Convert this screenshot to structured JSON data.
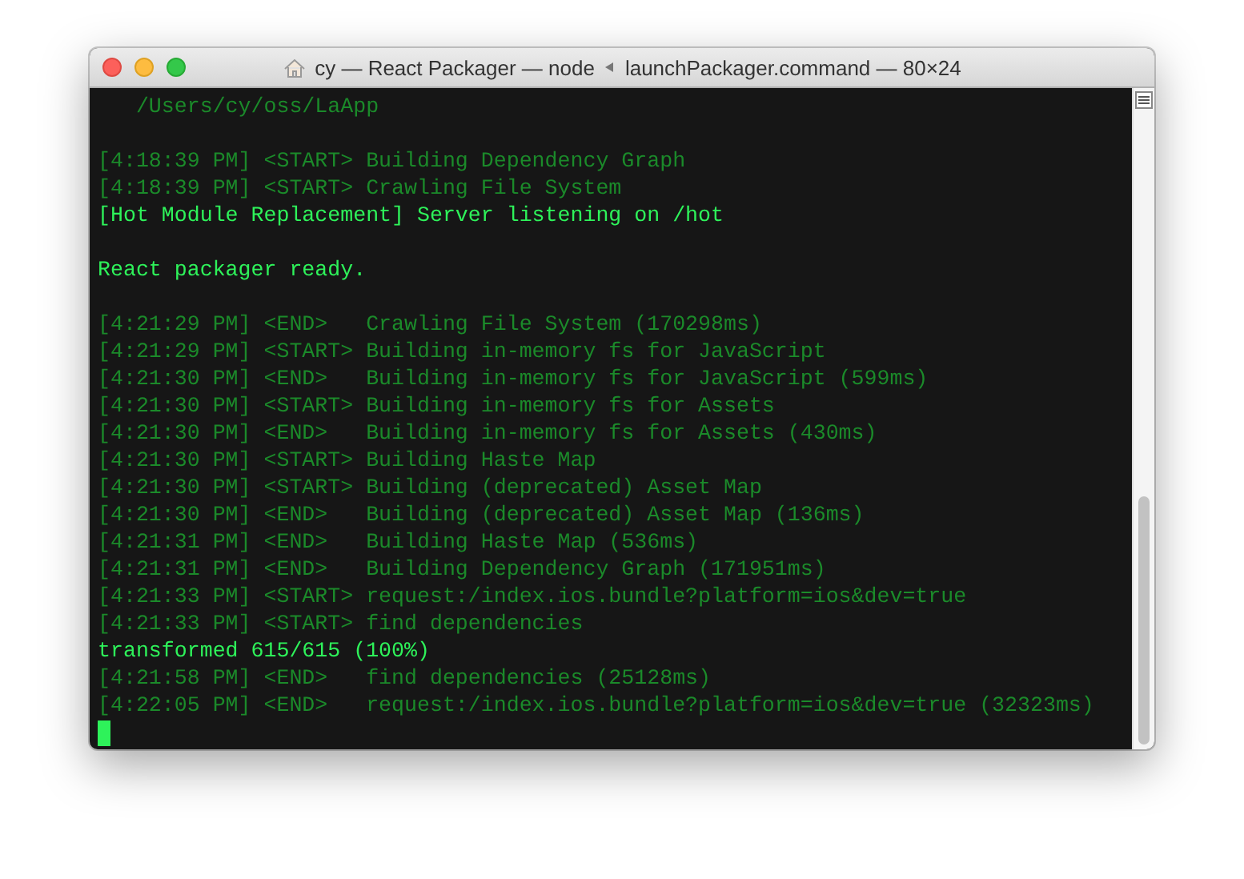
{
  "window": {
    "title_left": "cy — React Packager — node",
    "title_right": "launchPackager.command — 80×24"
  },
  "terminal": {
    "lines": [
      {
        "kind": "dim",
        "text": "   /Users/cy/oss/LaApp"
      },
      {
        "kind": "blank"
      },
      {
        "kind": "dim",
        "text": "[4:18:39 PM] <START> Building Dependency Graph"
      },
      {
        "kind": "dim",
        "text": "[4:18:39 PM] <START> Crawling File System"
      },
      {
        "kind": "bright",
        "text": "[Hot Module Replacement] Server listening on /hot"
      },
      {
        "kind": "blank"
      },
      {
        "kind": "bright",
        "text": "React packager ready."
      },
      {
        "kind": "blank"
      },
      {
        "kind": "dim",
        "text": "[4:21:29 PM] <END>   Crawling File System (170298ms)"
      },
      {
        "kind": "dim",
        "text": "[4:21:29 PM] <START> Building in-memory fs for JavaScript"
      },
      {
        "kind": "dim",
        "text": "[4:21:30 PM] <END>   Building in-memory fs for JavaScript (599ms)"
      },
      {
        "kind": "dim",
        "text": "[4:21:30 PM] <START> Building in-memory fs for Assets"
      },
      {
        "kind": "dim",
        "text": "[4:21:30 PM] <END>   Building in-memory fs for Assets (430ms)"
      },
      {
        "kind": "dim",
        "text": "[4:21:30 PM] <START> Building Haste Map"
      },
      {
        "kind": "dim",
        "text": "[4:21:30 PM] <START> Building (deprecated) Asset Map"
      },
      {
        "kind": "dim",
        "text": "[4:21:30 PM] <END>   Building (deprecated) Asset Map (136ms)"
      },
      {
        "kind": "dim",
        "text": "[4:21:31 PM] <END>   Building Haste Map (536ms)"
      },
      {
        "kind": "dim",
        "text": "[4:21:31 PM] <END>   Building Dependency Graph (171951ms)"
      },
      {
        "kind": "dim",
        "text": "[4:21:33 PM] <START> request:/index.ios.bundle?platform=ios&dev=true"
      },
      {
        "kind": "dim",
        "text": "[4:21:33 PM] <START> find dependencies"
      },
      {
        "kind": "bright",
        "text": "transformed 615/615 (100%)"
      },
      {
        "kind": "dim",
        "text": "[4:21:58 PM] <END>   find dependencies (25128ms)"
      },
      {
        "kind": "dim",
        "text": "[4:22:05 PM] <END>   request:/index.ios.bundle?platform=ios&dev=true (32323ms)"
      },
      {
        "kind": "cursor"
      }
    ]
  }
}
